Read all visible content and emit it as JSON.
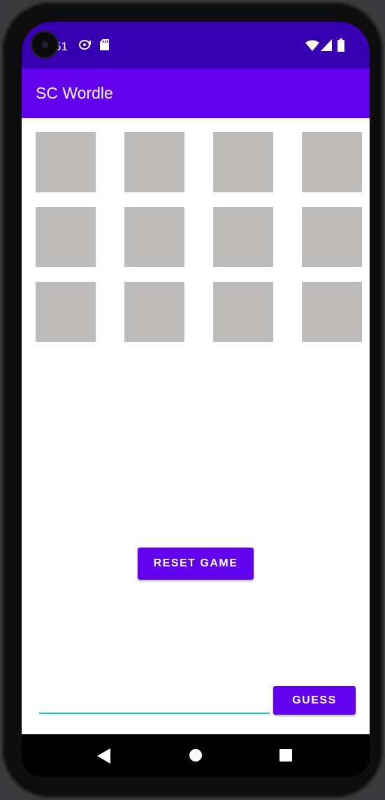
{
  "status_bar": {
    "time": "51",
    "icons": [
      "notification-icon",
      "sd-card-icon",
      "wifi-icon",
      "signal-icon",
      "battery-icon"
    ]
  },
  "app_bar": {
    "title": "SC Wordle"
  },
  "board": {
    "rows": 3,
    "columns": 4,
    "tiles": [
      "",
      "",
      "",
      "",
      "",
      "",
      "",
      "",
      "",
      "",
      "",
      ""
    ],
    "tile_color": "#bdbcbb"
  },
  "reset_button": {
    "label": "RESET GAME"
  },
  "guess": {
    "input_value": "",
    "button_label": "GUESS"
  },
  "nav_bar": {
    "icons": [
      "back-icon",
      "home-icon",
      "recents-icon"
    ]
  },
  "colors": {
    "status_bar": "#3700b3",
    "primary": "#6200ee",
    "input_underline": "#14c6c4"
  }
}
